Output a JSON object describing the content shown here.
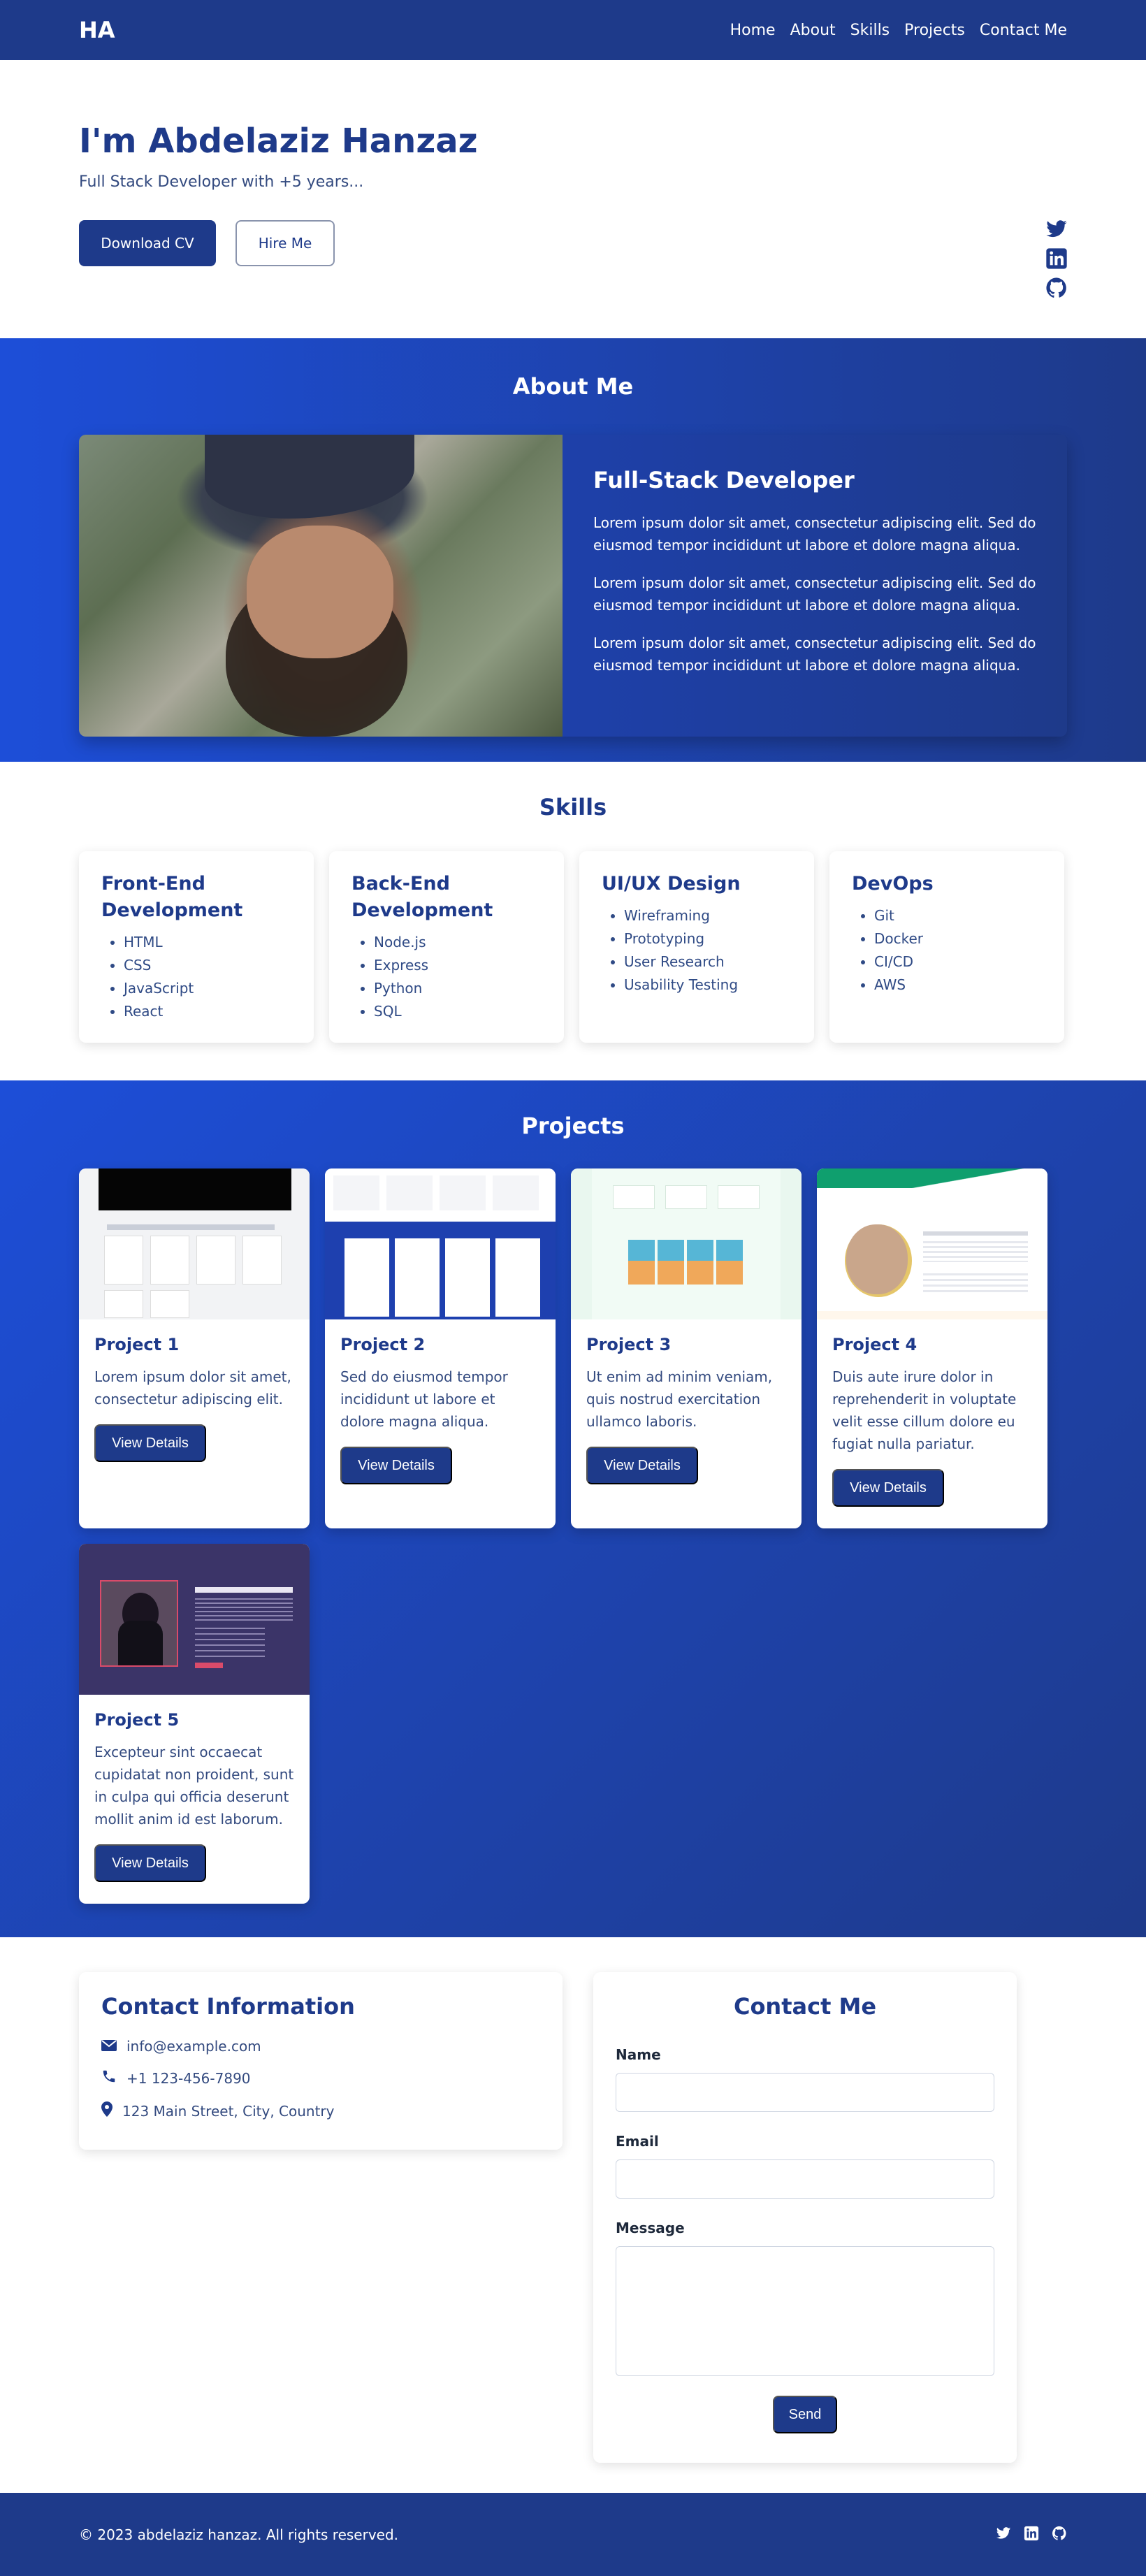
{
  "nav": {
    "logo": "HA",
    "links": [
      "Home",
      "About",
      "Skills",
      "Projects",
      "Contact Me"
    ]
  },
  "hero": {
    "title": "I'm Abdelaziz Hanzaz",
    "subtitle": "Full Stack Developer with +5 years...",
    "download_label": "Download CV",
    "hire_label": "Hire Me",
    "social_icons": [
      "twitter-icon",
      "linkedin-icon",
      "github-icon"
    ]
  },
  "about": {
    "heading": "About Me",
    "card_title": "Full-Stack Developer",
    "paragraphs": [
      "Lorem ipsum dolor sit amet, consectetur adipiscing elit. Sed do eiusmod tempor incididunt ut labore et dolore magna aliqua.",
      "Lorem ipsum dolor sit amet, consectetur adipiscing elit. Sed do eiusmod tempor incididunt ut labore et dolore magna aliqua.",
      "Lorem ipsum dolor sit amet, consectetur adipiscing elit. Sed do eiusmod tempor incididunt ut labore et dolore magna aliqua."
    ]
  },
  "skills": {
    "heading": "Skills",
    "cards": [
      {
        "title": "Front-End Development",
        "items": [
          "HTML",
          "CSS",
          "JavaScript",
          "React"
        ]
      },
      {
        "title": "Back-End Development",
        "items": [
          "Node.js",
          "Express",
          "Python",
          "SQL"
        ]
      },
      {
        "title": "UI/UX Design",
        "items": [
          "Wireframing",
          "Prototyping",
          "User Research",
          "Usability Testing"
        ]
      },
      {
        "title": "DevOps",
        "items": [
          "Git",
          "Docker",
          "CI/CD",
          "AWS"
        ]
      }
    ]
  },
  "projects": {
    "heading": "Projects",
    "button_label": "View Details",
    "items": [
      {
        "title": "Project 1",
        "desc": "Lorem ipsum dolor sit amet, consectetur adipiscing elit."
      },
      {
        "title": "Project 2",
        "desc": "Sed do eiusmod tempor incididunt ut labore et dolore magna aliqua."
      },
      {
        "title": "Project 3",
        "desc": "Ut enim ad minim veniam, quis nostrud exercitation ullamco laboris."
      },
      {
        "title": "Project 4",
        "desc": "Duis aute irure dolor in reprehenderit in voluptate velit esse cillum dolore eu fugiat nulla pariatur."
      },
      {
        "title": "Project 5",
        "desc": "Excepteur sint occaecat cupidatat non proident, sunt in culpa qui officia deserunt mollit anim id est laborum."
      }
    ]
  },
  "contact_info": {
    "heading": "Contact Information",
    "email": "info@example.com",
    "phone": "+1 123-456-7890",
    "address": "123 Main Street, City, Country"
  },
  "contact_form": {
    "heading": "Contact Me",
    "name_label": "Name",
    "email_label": "Email",
    "message_label": "Message",
    "send_label": "Send"
  },
  "footer": {
    "copyright": "© 2023 abdelaziz hanzaz. All rights reserved."
  },
  "colors": {
    "primary": "#1e3a8a",
    "accent": "#1d4ed8"
  }
}
